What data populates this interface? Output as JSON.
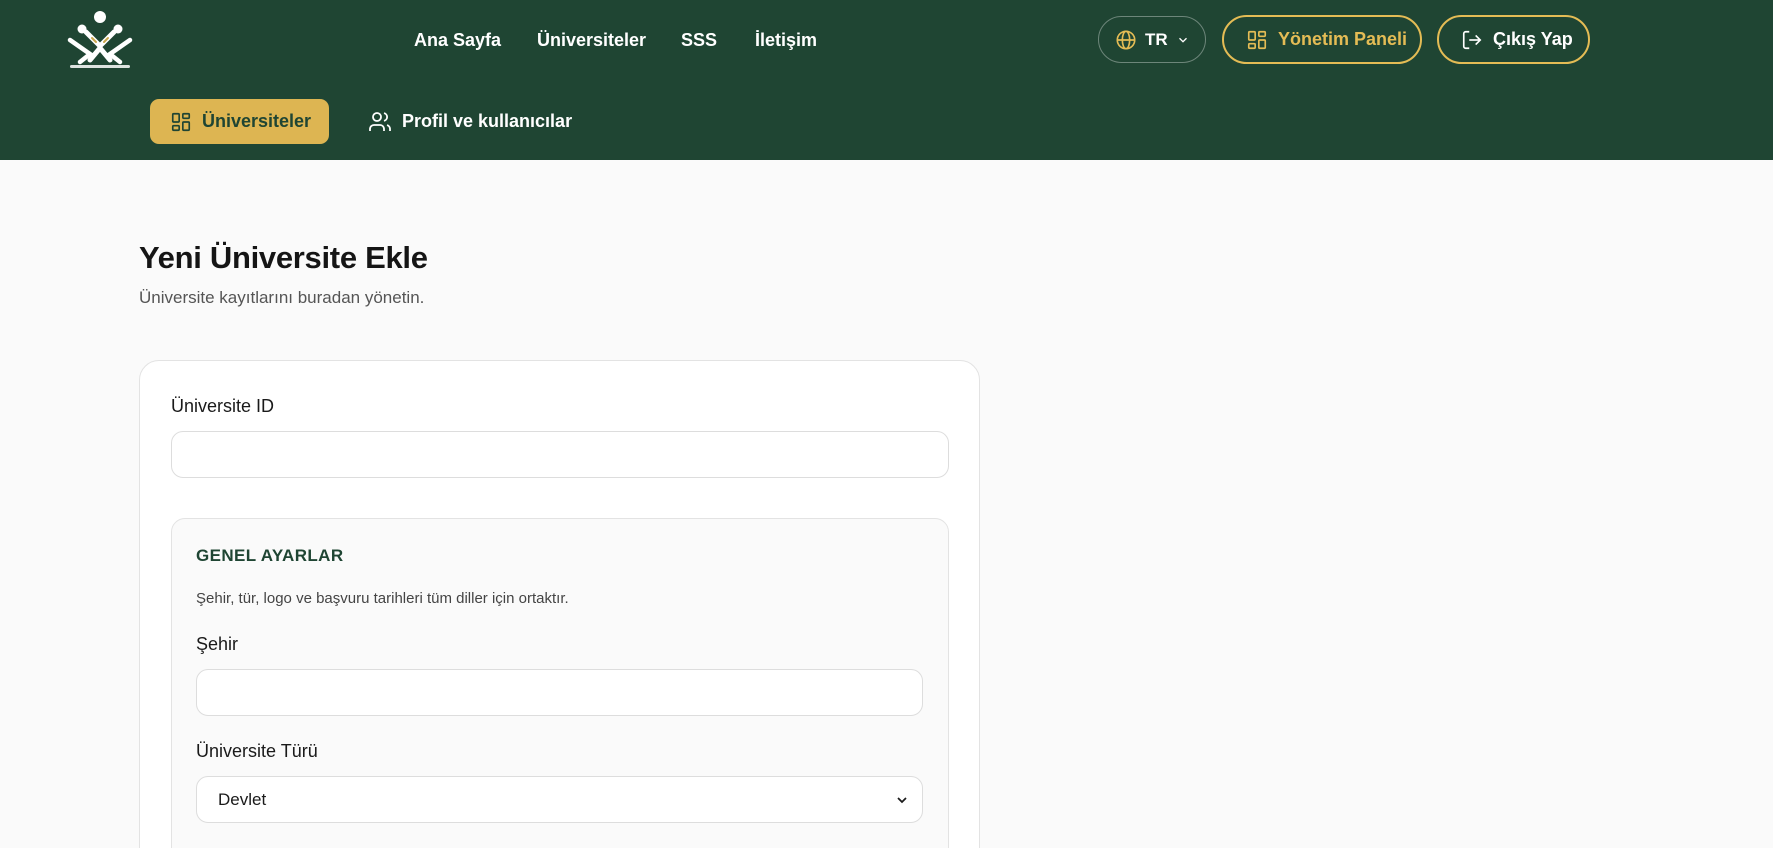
{
  "nav": {
    "items": [
      "Ana Sayfa",
      "Üniversiteler",
      "SSS",
      "İletişim"
    ]
  },
  "header": {
    "language": "TR",
    "admin_label": "Yönetim Paneli",
    "logout_label": "Çıkış Yap"
  },
  "subnav": {
    "universities": "Üniversiteler",
    "profiles": "Profil ve kullanıcılar"
  },
  "page": {
    "title": "Yeni Üniversite Ekle",
    "subtitle": "Üniversite kayıtlarını buradan yönetin."
  },
  "form": {
    "university_id_label": "Üniversite ID",
    "university_id_value": "",
    "general": {
      "title": "GENEL AYARLAR",
      "description": "Şehir, tür, logo ve başvuru tarihleri tüm diller için ortaktır.",
      "city_label": "Şehir",
      "city_value": "",
      "type_label": "Üniversite Türü",
      "type_value": "Devlet"
    }
  },
  "colors": {
    "header_bg": "#1f4533",
    "accent": "#e4bc55",
    "active_tab_bg": "#ddb552"
  },
  "icons": {
    "logo": "union-logo-icon",
    "language": "globe-icon",
    "language_dropdown": "chevron-down-icon",
    "admin": "dashboard-grid-icon",
    "logout": "logout-icon",
    "universities_tab": "dashboard-grid-icon",
    "profiles_tab": "users-icon",
    "select": "chevron-down-icon"
  }
}
